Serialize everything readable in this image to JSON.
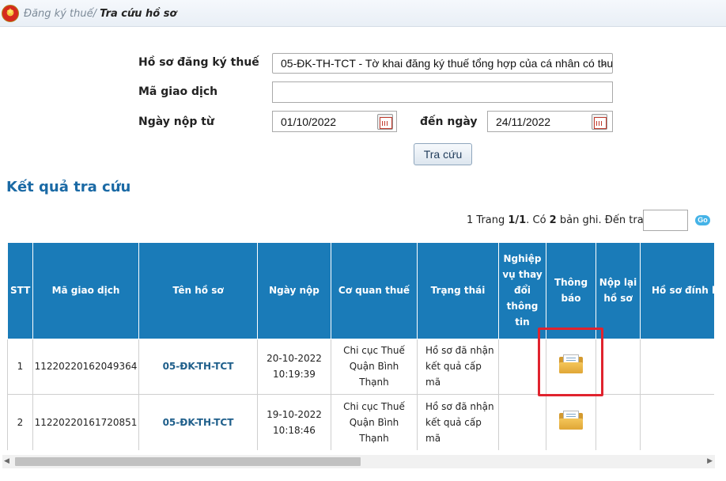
{
  "breadcrumb": {
    "parent": "Đăng ký thuế/",
    "current": "Tra cứu hồ sơ"
  },
  "form": {
    "ho_so_label": "Hồ sơ đăng ký thuế",
    "ho_so_value": "05-ĐK-TH-TCT - Tờ khai đăng ký thuế tổng hợp của cá nhân có thu",
    "ma_gd_label": "Mã giao dịch",
    "ma_gd_value": "",
    "ngay_nop_tu_label": "Ngày nộp từ",
    "ngay_nop_tu_value": "01/10/2022",
    "den_ngay_label": "đến ngày",
    "den_ngay_value": "24/11/2022",
    "search_button": "Tra cứu"
  },
  "results_heading": "Kết quả tra cứu",
  "pager": {
    "page": "1",
    "trang_prefix": "Trang ",
    "trang_value": "1/1",
    "co_prefix": ". Có ",
    "count": "2",
    "suffix": " bản ghi. Đến trang",
    "go_label": "Go",
    "goto_value": ""
  },
  "table": {
    "headers": [
      "STT",
      "Mã giao dịch",
      "Tên hồ sơ",
      "Ngày nộp",
      "Cơ quan thuế",
      "Trạng thái",
      "Nghiệp vụ thay đổi thông tin",
      "Thông báo",
      "Nộp lại hồ sơ",
      "Hồ sơ đính kèm"
    ],
    "rows": [
      {
        "stt": "1",
        "ma_gd": "11220220162049364",
        "ten": "05-ĐK-TH-TCT",
        "ngay": "20-10-2022",
        "gio": "10:19:39",
        "co_quan": "Chi cục Thuế Quận Bình Thạnh",
        "trang_thai": "Hồ sơ đã nhận kết quả cấp mã"
      },
      {
        "stt": "2",
        "ma_gd": "11220220161720851",
        "ten": "05-ĐK-TH-TCT",
        "ngay": "19-10-2022",
        "gio": "10:18:46",
        "co_quan": "Chi cục Thuế Quận Bình Thạnh",
        "trang_thai": "Hồ sơ đã nhận kết quả cấp mã"
      }
    ]
  },
  "icons": {
    "thong_bao": "folder-document-icon",
    "calendar": "calendar-icon",
    "emblem": "national-emblem-icon"
  },
  "colors": {
    "header_blue": "#1a7bb8",
    "heading_blue": "#1b6aa5",
    "highlight_red": "#e0232e",
    "link_blue": "#1f5f8b"
  }
}
